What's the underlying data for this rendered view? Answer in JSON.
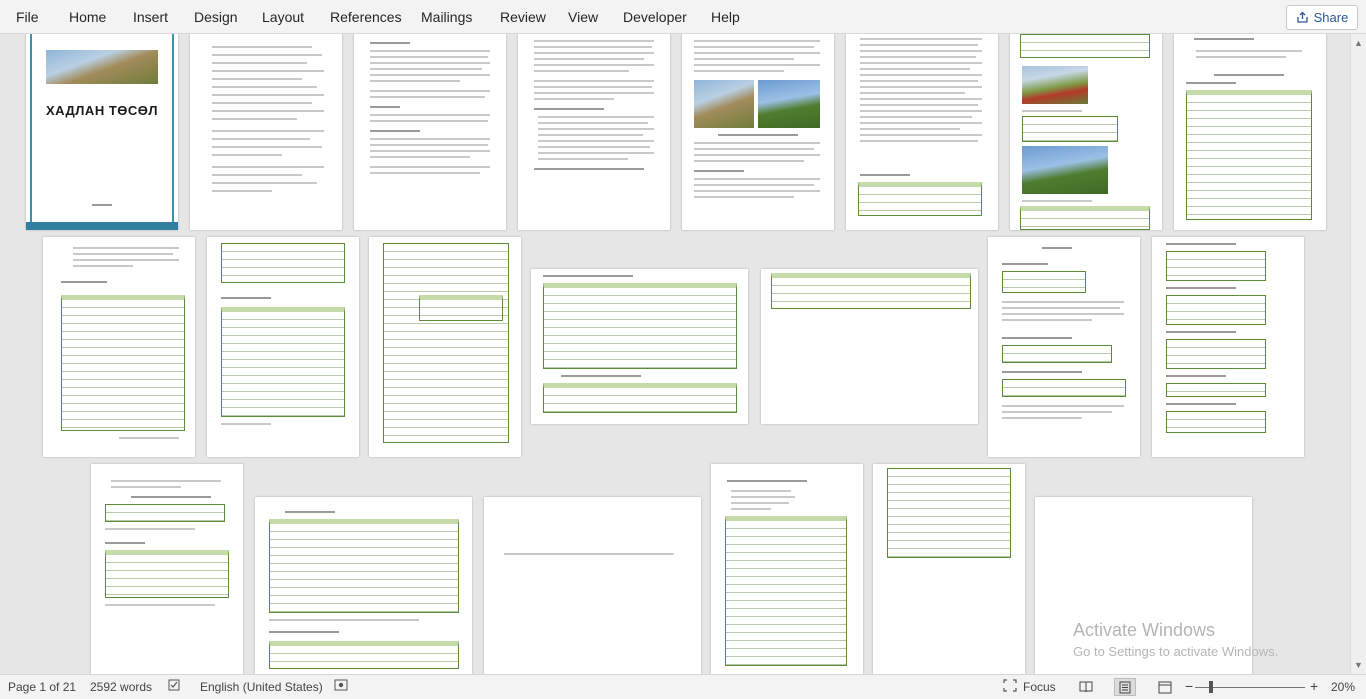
{
  "ribbon": {
    "tabs": [
      "File",
      "Home",
      "Insert",
      "Design",
      "Layout",
      "References",
      "Mailings",
      "Review",
      "View",
      "Developer",
      "Help"
    ],
    "share_label": "Share"
  },
  "document": {
    "cover_title": "ХАДЛАН ТӨСӨЛ"
  },
  "watermark": {
    "line1": "Activate Windows",
    "line2": "Go to Settings to activate Windows."
  },
  "status": {
    "page": "Page 1 of 21",
    "words": "2592 words",
    "language": "English (United States)",
    "focus": "Focus",
    "zoom": "20%"
  },
  "icons": {
    "share": "share-icon",
    "proofing": "proofing-icon",
    "macro": "macro-record-icon",
    "accessibility": "accessibility-icon",
    "focus": "focus-icon",
    "read_mode": "read-mode-icon",
    "print_layout": "print-layout-icon",
    "web_layout": "web-layout-icon"
  }
}
